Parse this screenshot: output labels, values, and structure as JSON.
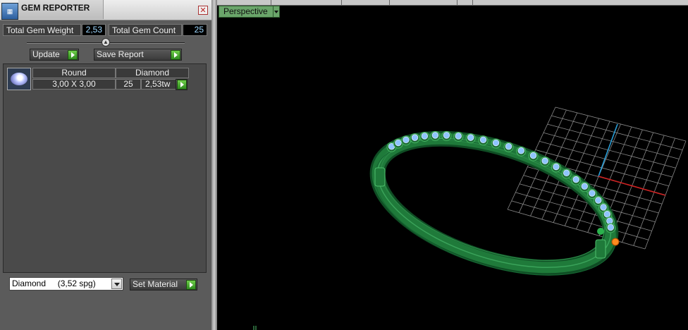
{
  "window": {
    "title": "GEM REPORTER",
    "icon": "gem-reporter-app-icon",
    "close_symbol": "✕"
  },
  "summary": {
    "total_weight_label": "Total Gem Weight",
    "total_weight_value": "2,53",
    "total_count_label": "Total Gem Count",
    "total_count_value": "25"
  },
  "actions": {
    "update_label": "Update",
    "save_label": "Save Report"
  },
  "gem_table": {
    "rows": [
      {
        "shape": "Round",
        "type": "Diamond",
        "size": "3,00 X 3,00",
        "count": "25",
        "weight": "2,53tw"
      }
    ]
  },
  "material": {
    "selected": "Diamond     (3,52 spg)",
    "set_label": "Set Material"
  },
  "viewport": {
    "view_mode": "Perspective"
  },
  "colors": {
    "panel_bg": "#5b5b5b",
    "accent_green": "#3c9e28",
    "ring_green": "#1f7a3a",
    "gem_blue": "#8fc4ff",
    "grid": "#9a9a9a",
    "axis_red": "#cc2222",
    "axis_blue": "#2a9fd8"
  }
}
